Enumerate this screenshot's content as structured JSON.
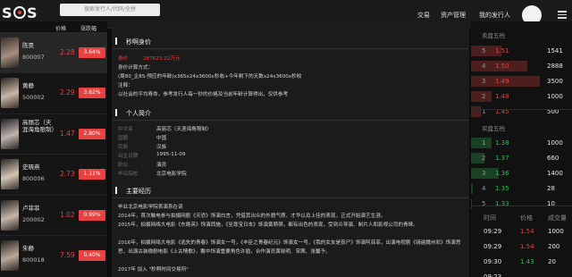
{
  "search": {
    "placeholder": "搜索发行人/代码/全拼"
  },
  "nav": {
    "items": [
      "交易",
      "资产管理",
      "我的发行人"
    ]
  },
  "colors": {
    "up": "#e8413f",
    "down": "#2fbd55",
    "bg": "#0c0c0c"
  },
  "left": {
    "headers": [
      "价格",
      "涨跌幅"
    ],
    "rows": [
      {
        "name": "陈昊",
        "code": "800007",
        "price": "2.28",
        "change": "3.64%",
        "selected": true
      },
      {
        "name": "黄静",
        "code": "500002",
        "price": "2.29",
        "change": "3.62%"
      },
      {
        "name": "高丽芯（天涯海角限制）",
        "code": "",
        "price": "1.47",
        "change": "2.80%"
      },
      {
        "name": "史晓燕",
        "code": "800006",
        "price": "2.73",
        "change": "1.11%"
      },
      {
        "name": "卢菲菲",
        "code": "200002",
        "price": "1.02",
        "change": "0.99%"
      },
      {
        "name": "朱静",
        "code": "800018",
        "price": "7.59",
        "change": "0.40%"
      }
    ]
  },
  "main": {
    "section1_title": "秒啊身价",
    "valuation_label": "身价",
    "valuation_value": "287623.22万元",
    "method_lines": [
      "身价计算方式：",
      "(周80_企85-预应的年龄)x365x24x3600x秒收+今年剩下的天数x24x3600x秒收",
      "注释：",
      "以社会的平均寿命，参考发行人每一秒的价格及当前年龄计算得出，仅供参考"
    ],
    "section2_title": "个人简介",
    "profile": [
      {
        "label": "中文名",
        "value": "高丽芯（天涯海角限制）"
      },
      {
        "label": "国籍",
        "value": "中国"
      },
      {
        "label": "民族",
        "value": "汉族"
      },
      {
        "label": "出生日期",
        "value": "1995-11-09"
      },
      {
        "label": "职业",
        "value": "演员"
      },
      {
        "label": "毕业院校",
        "value": "北京电影学院"
      }
    ],
    "section3_title": "主要经历",
    "experience": [
      "毕业北京电影学院表演系在读",
      "2014年，首次触电参与拍摄网剧《天恐》饰演白言，凭借其出众的外貌气质、才华以及上佳的表现，正式开始演艺生涯。",
      "2015年，拍摄网络大电影《东晚英》饰演西施，《至尊宝日本》饰演黄萌萌，都有出色的表现，受到众导演、制片人和影视公司的青睐。",
      "2016年，拍摄网络大电影《逃失的青春》饰演女一号，《丰臣之青春纪元》饰演女一号，《我的女友是丧尸》饰演阿菲菲，出演电视剧《骑遍魏州彩》饰演思思，出演古装微剧电影《上古情歌》，戴中饰演重要角色许眉，合作演员黄晓明、宋茜、张馨予。",
      "2017年 加入 \"秒啊时间交易所\""
    ]
  },
  "right": {
    "ask_title": "卖盘五档",
    "bid_title": "买盘五档",
    "asks": [
      {
        "label": "5",
        "price": "1.51",
        "qty": "1541",
        "depth": 0.3
      },
      {
        "label": "4",
        "price": "1.50",
        "qty": "2888",
        "depth": 0.56
      },
      {
        "label": "3",
        "price": "1.49",
        "qty": "3500",
        "depth": 0.68
      },
      {
        "label": "2",
        "price": "1.48",
        "qty": "1000",
        "depth": 0.2
      },
      {
        "label": "1",
        "price": "1.45",
        "qty": "500",
        "depth": 0.1
      }
    ],
    "bids": [
      {
        "label": "1",
        "price": "1.38",
        "qty": "1000",
        "depth": 0.2
      },
      {
        "label": "2",
        "price": "1.37",
        "qty": "660",
        "depth": 0.13
      },
      {
        "label": "3",
        "price": "1.36",
        "qty": "1400",
        "depth": 0.27
      },
      {
        "label": "4",
        "price": "1.35",
        "qty": "28",
        "depth": 0.02
      },
      {
        "label": "5",
        "price": "1.33",
        "qty": "10",
        "depth": 0.01
      }
    ],
    "trade_headers": [
      "时间",
      "价格",
      "成交量"
    ],
    "trades": [
      {
        "time": "09:29",
        "price": "1.54",
        "qty": "1000",
        "up": true
      },
      {
        "time": "09:29",
        "price": "1.54",
        "qty": "200",
        "up": true
      },
      {
        "time": "09:30",
        "price": "1.43",
        "qty": "20",
        "up": false
      },
      {
        "time": "09:23",
        "price": "",
        "qty": "",
        "up": false
      }
    ]
  }
}
